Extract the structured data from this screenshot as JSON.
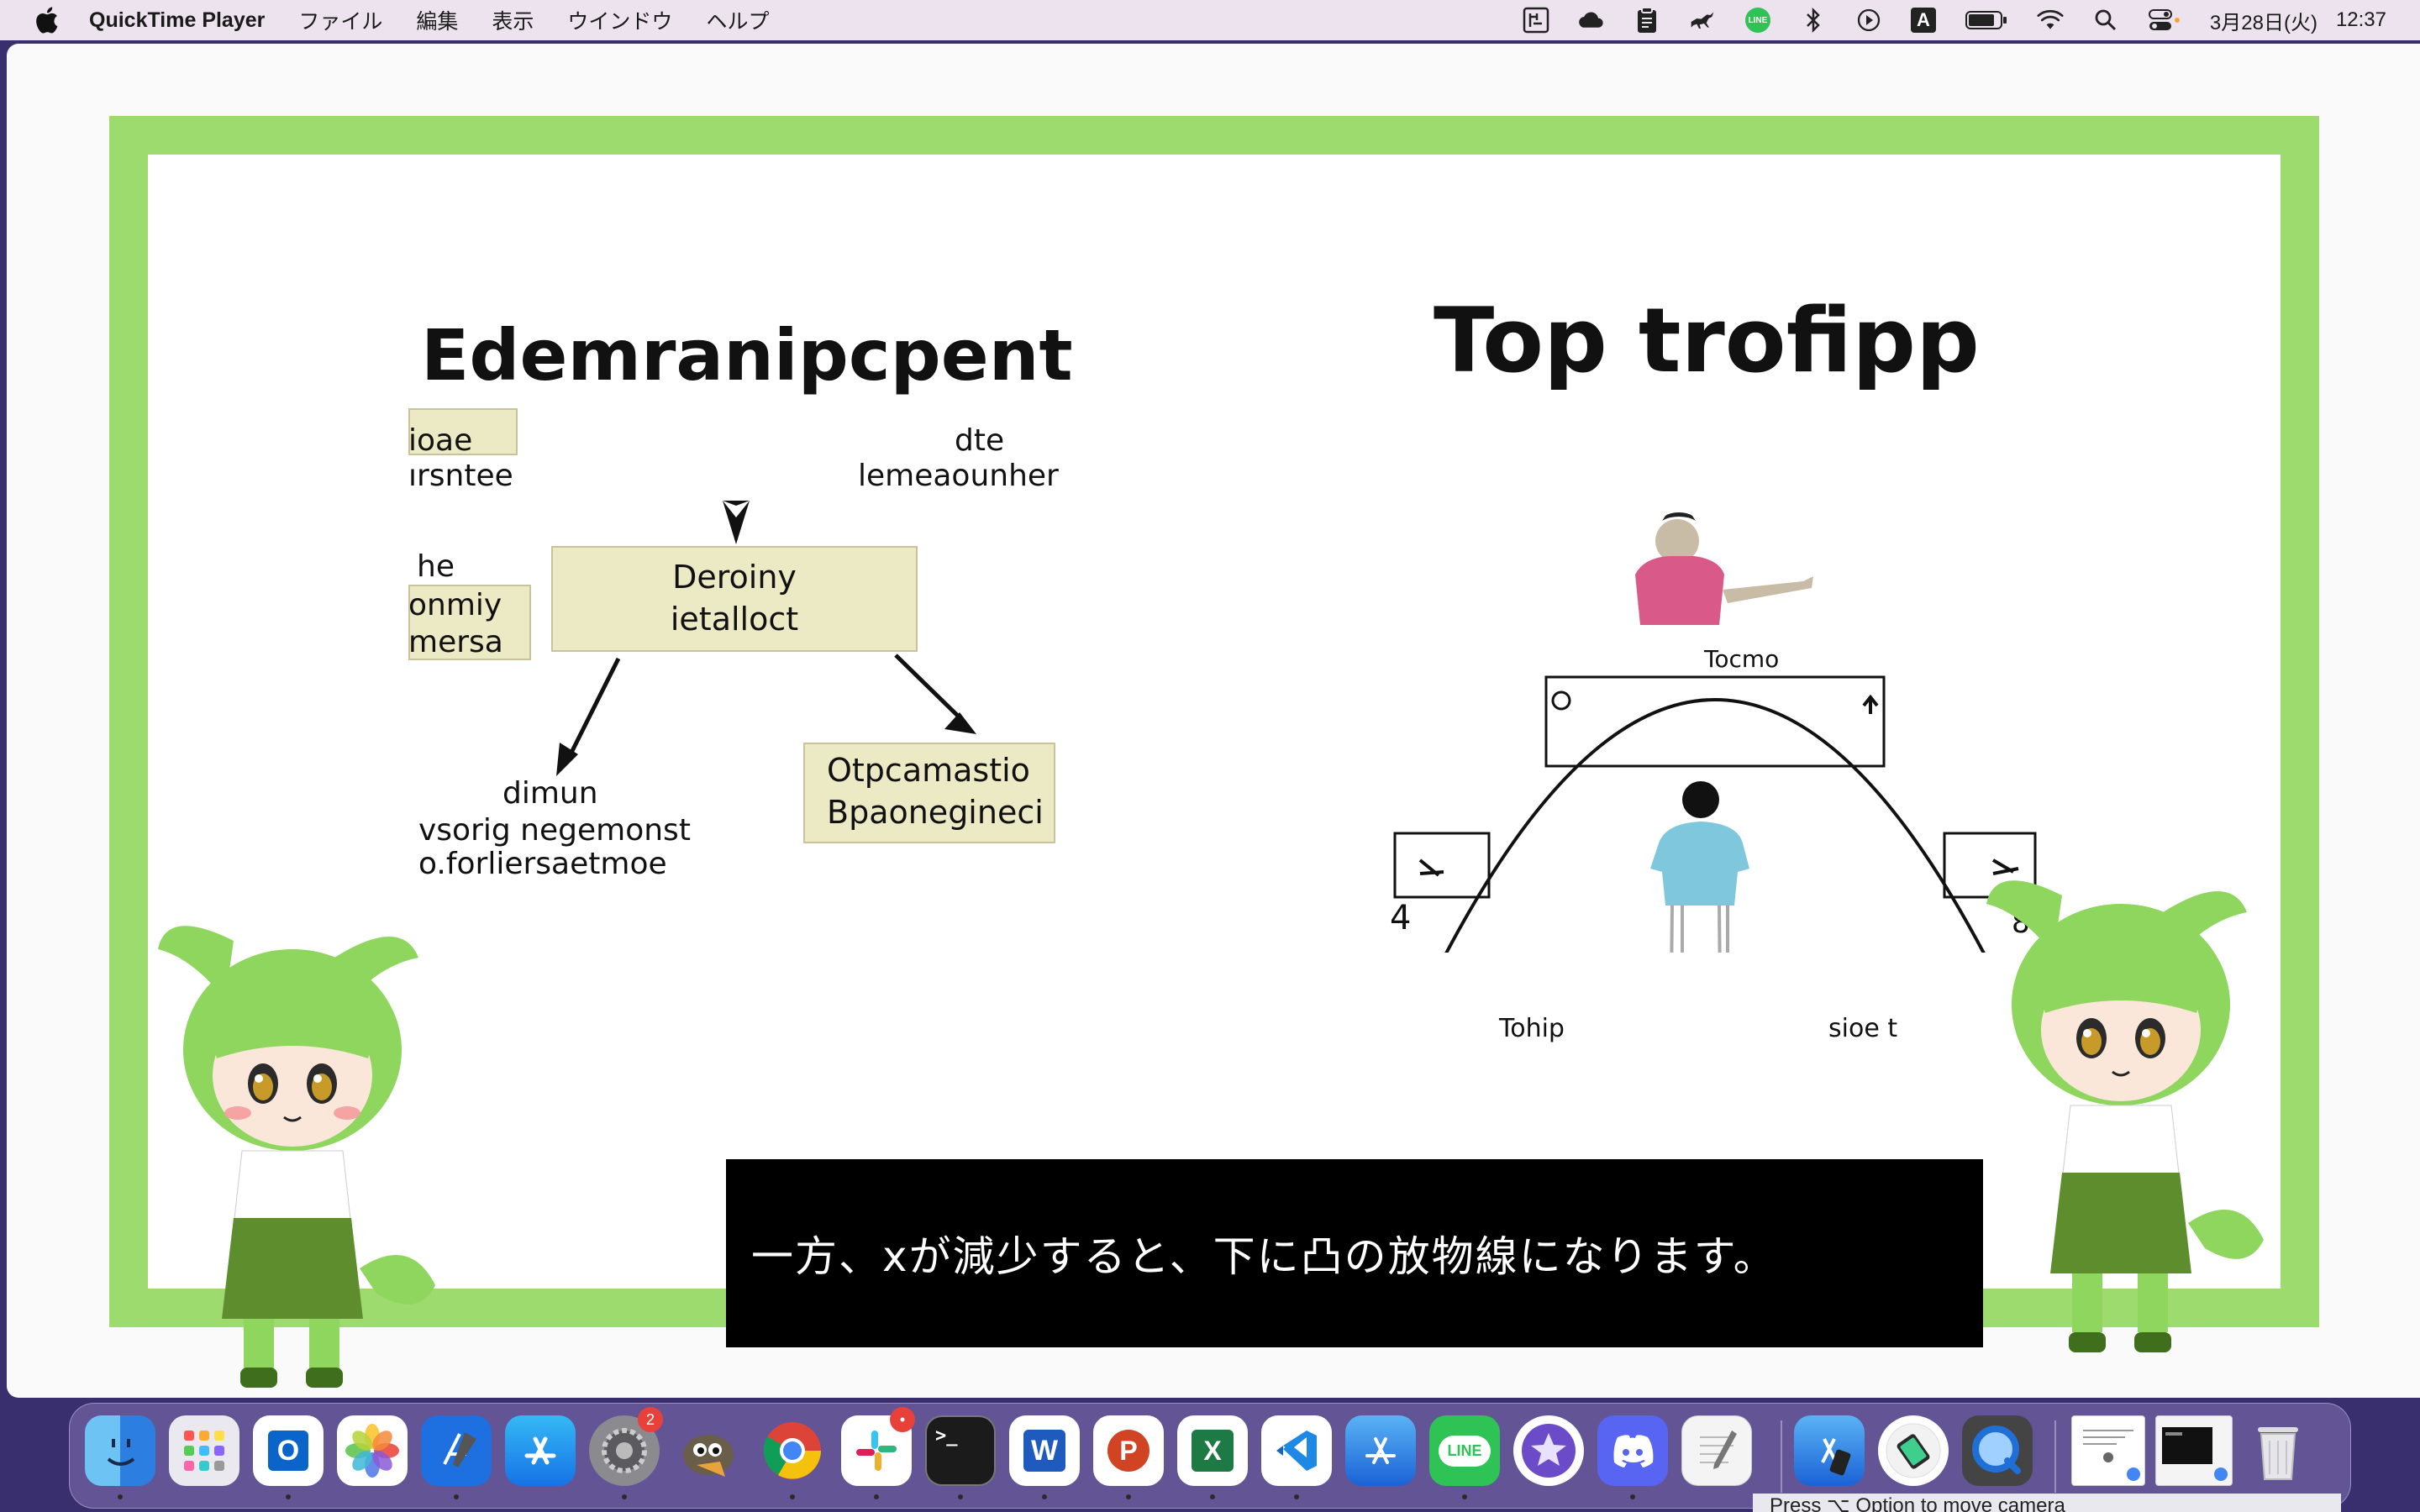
{
  "menubar": {
    "app_name": "QuickTime Player",
    "menus": [
      "ファイル",
      "編集",
      "表示",
      "ウインドウ",
      "ヘルプ"
    ],
    "status_icons": [
      "keyboard-input-icon",
      "cloud-icon",
      "clipboard-icon",
      "horse-icon",
      "line-icon",
      "bluetooth-icon",
      "play-icon",
      "input-source-icon",
      "battery-icon",
      "wifi-icon",
      "search-icon",
      "control-center-icon"
    ],
    "input_source": "A",
    "line_label": "LINE",
    "date": "3月28日(火)",
    "time": "12:37"
  },
  "video": {
    "left_diagram": {
      "title": "Edemranipcpent",
      "labels": [
        "ioae",
        "ırsntee",
        "dte",
        "lemeaounher",
        "he",
        "onmiy",
        "mersa",
        "dimun",
        "vsorig negemonst",
        "o.forliersaetmoe"
      ],
      "center_box": [
        "Deroiny",
        "ietalloct"
      ],
      "right_box": [
        "Otpcamastio",
        "Bpaonegineci"
      ]
    },
    "right_diagram": {
      "title": "Top trofipp",
      "labels": [
        "Tocmo",
        "4",
        "8",
        "Tohip",
        "sioe t"
      ]
    },
    "subtitle": "一方、xが減少すると、下に凸の放物線になります。"
  },
  "dock": {
    "apps": [
      {
        "name": "Finder",
        "icon": "finder-icon"
      },
      {
        "name": "Launchpad",
        "icon": "launchpad-icon"
      },
      {
        "name": "Outlook",
        "icon": "outlook-icon"
      },
      {
        "name": "Photos",
        "icon": "photos-icon"
      },
      {
        "name": "Xcode",
        "icon": "xcode-icon"
      },
      {
        "name": "App Store",
        "icon": "app-store-icon"
      },
      {
        "name": "System Preferences",
        "icon": "settings-icon",
        "badge": "2"
      },
      {
        "name": "GIMP",
        "icon": "gimp-icon"
      },
      {
        "name": "Chrome",
        "icon": "chrome-icon"
      },
      {
        "name": "Slack",
        "icon": "slack-icon",
        "badge": "•"
      },
      {
        "name": "Terminal",
        "icon": "terminal-icon"
      },
      {
        "name": "Word",
        "icon": "word-icon"
      },
      {
        "name": "PowerPoint",
        "icon": "powerpoint-icon"
      },
      {
        "name": "Excel",
        "icon": "excel-icon"
      },
      {
        "name": "VS Code",
        "icon": "vscode-icon"
      },
      {
        "name": "Instruments",
        "icon": "instruments-icon"
      },
      {
        "name": "LINE",
        "icon": "line-icon"
      },
      {
        "name": "iMovie",
        "icon": "imovie-icon"
      },
      {
        "name": "Discord",
        "icon": "discord-icon"
      },
      {
        "name": "TextEdit",
        "icon": "textedit-icon"
      },
      {
        "name": "Simulator",
        "icon": "simulator-icon"
      },
      {
        "name": "Apple Configurator",
        "icon": "configurator-icon"
      },
      {
        "name": "QuickTime Player",
        "icon": "quicktime-icon"
      },
      {
        "name": "Recent Document 1",
        "icon": "document-thumbnail-icon"
      },
      {
        "name": "Recent Document 2",
        "icon": "window-thumbnail-icon"
      },
      {
        "name": "Trash",
        "icon": "trash-icon"
      }
    ],
    "glyphs": {
      "outlook": "O",
      "terminal": ">_",
      "word": "W",
      "powerpoint": "P",
      "excel": "X",
      "line": "LINE"
    },
    "hint_text": "Press ⌥ Option to move camera"
  }
}
